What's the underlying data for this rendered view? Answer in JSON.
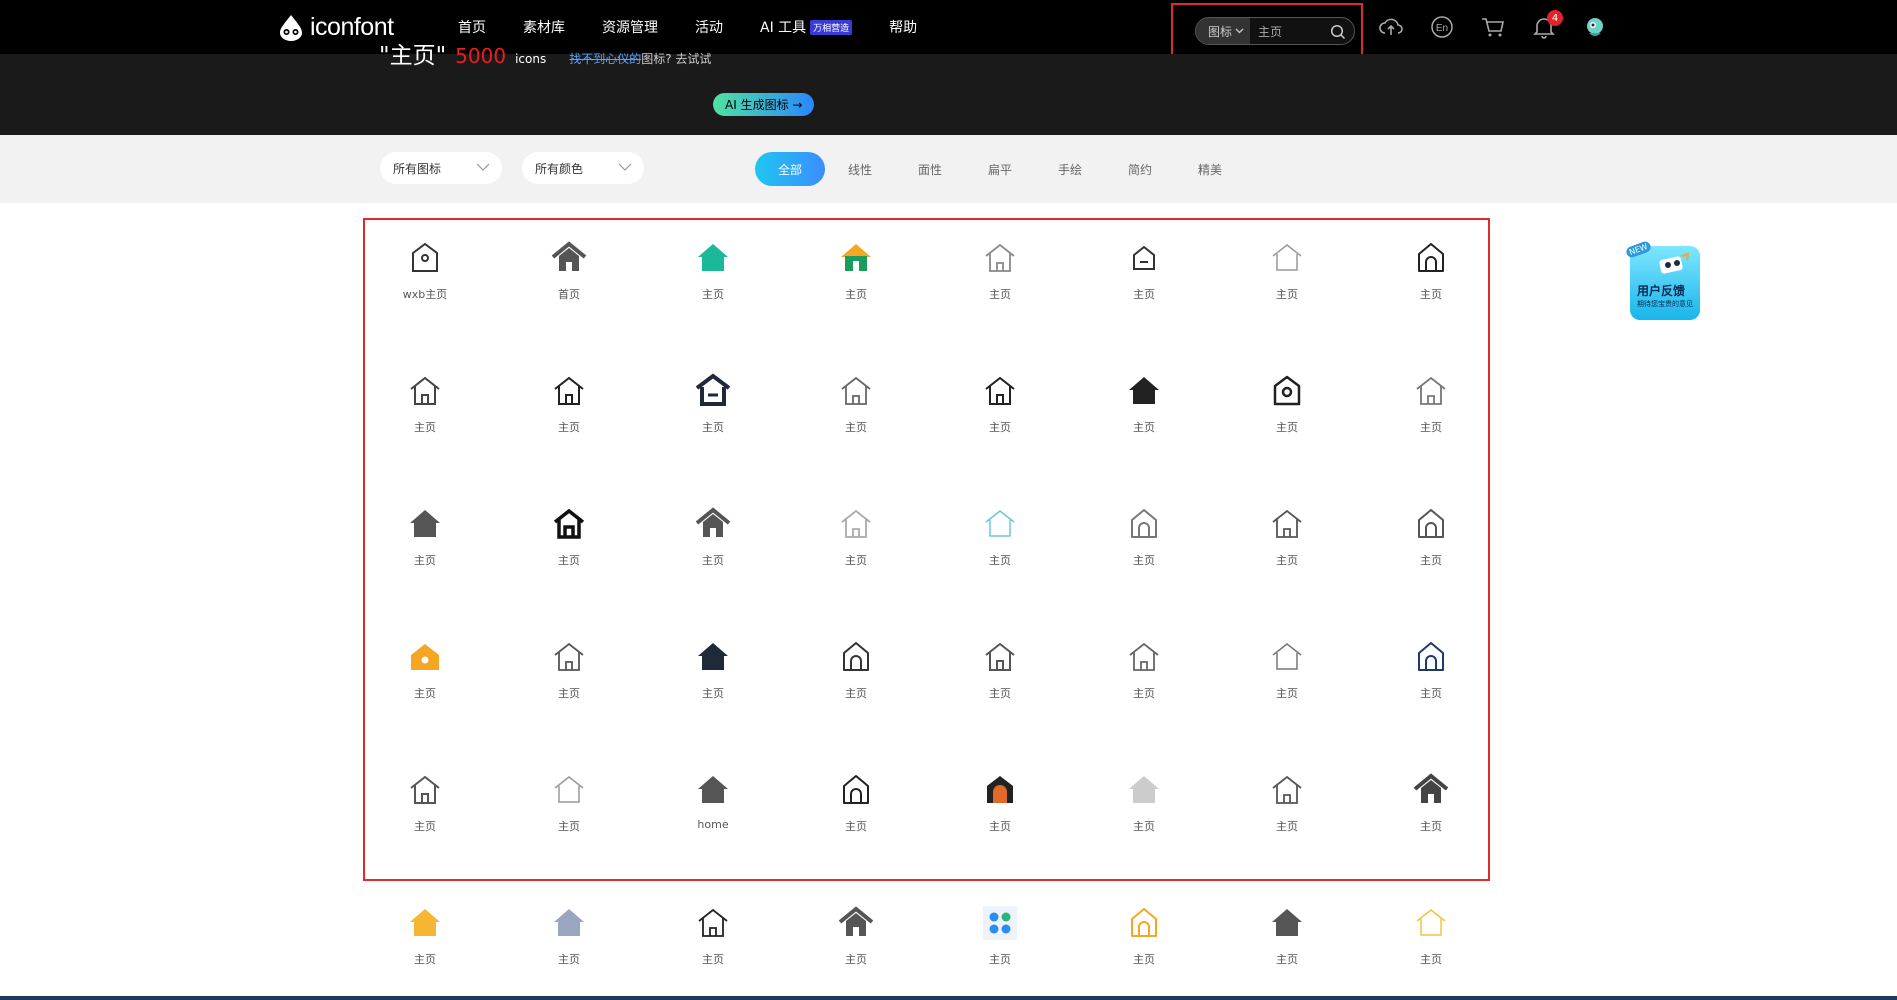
{
  "app": {
    "logo_text": "iconfont"
  },
  "nav": {
    "items": [
      "首页",
      "素材库",
      "资源管理",
      "活动",
      "AI 工具",
      "帮助"
    ],
    "ai_badge": "万相营造"
  },
  "search": {
    "type_label": "图标",
    "value": "主页"
  },
  "notifications": {
    "count": "4"
  },
  "hero": {
    "query": "\"主页\"",
    "count": "5000",
    "unit": "icons",
    "hint_link": "找不到心仪的",
    "hint_text": "图标? 去试试",
    "ai_button": "AI 生成图标 →"
  },
  "filters": {
    "icon_select": "所有图标",
    "color_select": "所有颜色",
    "styles": [
      "全部",
      "线性",
      "面性",
      "扁平",
      "手绘",
      "简约",
      "精美"
    ],
    "active_style": "全部"
  },
  "feedback": {
    "title": "用户反馈",
    "subtitle": "期待您宝贵的意见",
    "new_tag": "NEW"
  },
  "icons": [
    {
      "label": "wxb主页",
      "style": "outline-dot",
      "color": "#333333"
    },
    {
      "label": "首页",
      "style": "solid-roof",
      "color": "#555555"
    },
    {
      "label": "主页",
      "style": "solid",
      "color": "#1bb89a"
    },
    {
      "label": "主页",
      "style": "flat-orange-roof",
      "color": "#1a9c5e"
    },
    {
      "label": "主页",
      "style": "outline-thin",
      "color": "#888888"
    },
    {
      "label": "主页",
      "style": "outline-minus",
      "color": "#333333"
    },
    {
      "label": "主页",
      "style": "outline-light",
      "color": "#999999"
    },
    {
      "label": "主页",
      "style": "outline-arch",
      "color": "#222222"
    },
    {
      "label": "主页",
      "style": "outline-door",
      "color": "#444444"
    },
    {
      "label": "主页",
      "style": "outline-door",
      "color": "#222222"
    },
    {
      "label": "主页",
      "style": "bold-minus",
      "color": "#1e2a3a"
    },
    {
      "label": "主页",
      "style": "outline-thin",
      "color": "#666666"
    },
    {
      "label": "主页",
      "style": "outline-door",
      "color": "#222222"
    },
    {
      "label": "主页",
      "style": "solid",
      "color": "#222222"
    },
    {
      "label": "主页",
      "style": "outline-circle",
      "color": "#222222"
    },
    {
      "label": "主页",
      "style": "outline-thin",
      "color": "#777777"
    },
    {
      "label": "主页",
      "style": "solid",
      "color": "#555555"
    },
    {
      "label": "主页",
      "style": "bold-outline",
      "color": "#111111"
    },
    {
      "label": "主页",
      "style": "solid-roof",
      "color": "#555555"
    },
    {
      "label": "主页",
      "style": "outline-thin",
      "color": "#aaaaaa"
    },
    {
      "label": "主页",
      "style": "outline-light",
      "color": "#6ac9d6"
    },
    {
      "label": "主页",
      "style": "outline-arch",
      "color": "#777777"
    },
    {
      "label": "主页",
      "style": "outline-thin",
      "color": "#555555"
    },
    {
      "label": "主页",
      "style": "outline-arch",
      "color": "#555555"
    },
    {
      "label": "主页",
      "style": "solid-dot",
      "color": "#f5a623"
    },
    {
      "label": "主页",
      "style": "outline-thin",
      "color": "#555555"
    },
    {
      "label": "主页",
      "style": "solid",
      "color": "#1e2a3a"
    },
    {
      "label": "主页",
      "style": "outline-arch",
      "color": "#333333"
    },
    {
      "label": "主页",
      "style": "outline-door",
      "color": "#555555"
    },
    {
      "label": "主页",
      "style": "outline-thin",
      "color": "#666666"
    },
    {
      "label": "主页",
      "style": "outline-light",
      "color": "#777777"
    },
    {
      "label": "主页",
      "style": "outline-arch",
      "color": "#1e3a6a"
    },
    {
      "label": "主页",
      "style": "outline-door",
      "color": "#555555"
    },
    {
      "label": "主页",
      "style": "outline-light",
      "color": "#999999"
    },
    {
      "label": "home",
      "style": "solid",
      "color": "#555555"
    },
    {
      "label": "主页",
      "style": "outline-arch",
      "color": "#222222"
    },
    {
      "label": "主页",
      "style": "solid-arch",
      "color": "#e06a2a"
    },
    {
      "label": "主页",
      "style": "solid",
      "color": "#cccccc"
    },
    {
      "label": "主页",
      "style": "outline-thin",
      "color": "#555555"
    },
    {
      "label": "主页",
      "style": "solid-roof",
      "color": "#444444"
    },
    {
      "label": "主页",
      "style": "solid",
      "color": "#f5b731"
    },
    {
      "label": "主页",
      "style": "solid",
      "color": "#9aa5c0"
    },
    {
      "label": "主页",
      "style": "outline-thin",
      "color": "#222222"
    },
    {
      "label": "主页",
      "style": "solid-roof",
      "color": "#555555"
    },
    {
      "label": "主页",
      "style": "apps",
      "color": "#2d8cf0"
    },
    {
      "label": "主页",
      "style": "outline-arch",
      "color": "#f5a623"
    },
    {
      "label": "主页",
      "style": "solid",
      "color": "#555555"
    },
    {
      "label": "主页",
      "style": "outline-light",
      "color": "#f5c342"
    }
  ]
}
